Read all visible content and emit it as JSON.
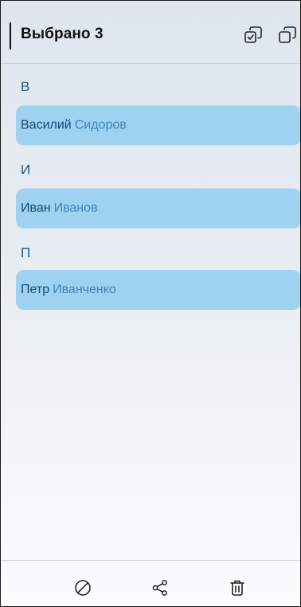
{
  "header": {
    "title": "Выбрано 3",
    "select_all_icon": "select-all-icon",
    "copy_icon": "copy-icon"
  },
  "sections": [
    {
      "letter": "В",
      "contact": {
        "first_name": "Василий",
        "last_name": "Сидоров"
      }
    },
    {
      "letter": "И",
      "contact": {
        "first_name": "Иван",
        "last_name": "Иванов"
      }
    },
    {
      "letter": "П",
      "contact": {
        "first_name": "Петр",
        "last_name": "Иванченко"
      }
    }
  ],
  "bottom_bar": {
    "icons": [
      "block-icon",
      "share-icon",
      "trash-icon"
    ]
  },
  "colors": {
    "selected_item_bg": "#9dd3f1",
    "first_name": "#154a72",
    "last_name": "#3d86b8",
    "section_letter": "#1a5a86"
  }
}
